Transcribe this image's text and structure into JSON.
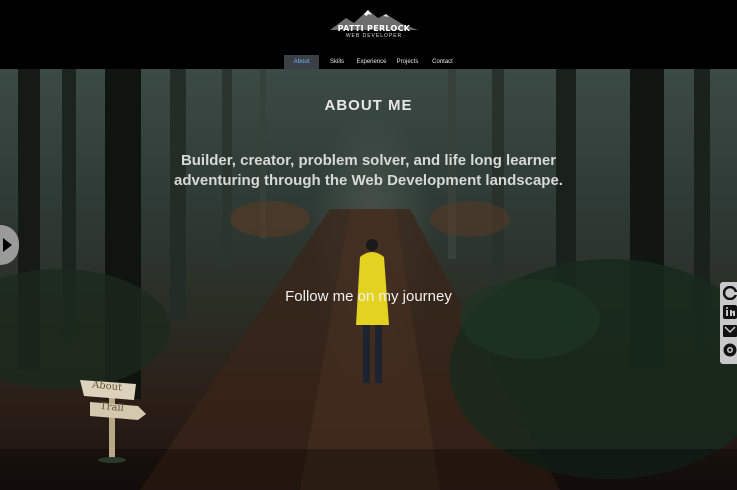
{
  "header": {
    "logo_name": "PATTI PERLOCK",
    "logo_subtitle": "WEB DEVELOPER",
    "nav": [
      {
        "label": "About",
        "active": true
      },
      {
        "label": "Skills",
        "active": false
      },
      {
        "label": "Experience",
        "active": false
      },
      {
        "label": "Projects",
        "active": false
      },
      {
        "label": "Contact",
        "active": false
      }
    ]
  },
  "hero": {
    "title": "ABOUT ME",
    "tagline": "Builder, creator, problem solver, and life long learner adventuring through the Web Development landscape.",
    "follow_text": "Follow me on my journey",
    "signpost": {
      "top": "About",
      "bottom": "Trail"
    }
  },
  "social": {
    "icons": [
      "github-icon",
      "linkedin-icon",
      "email-icon",
      "camera-icon"
    ]
  },
  "colors": {
    "active_nav_bg": "#3b4046",
    "active_nav_text": "#6fb6ff",
    "social_bg": "#c9c9c9"
  }
}
